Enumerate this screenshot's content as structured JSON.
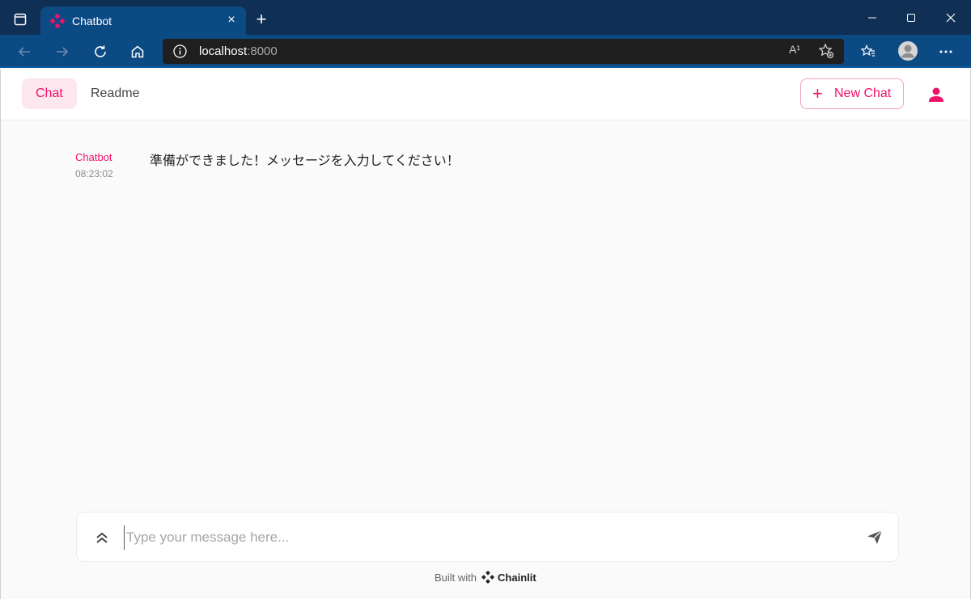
{
  "browser": {
    "tab_title": "Chatbot",
    "tab_close": "×",
    "new_tab": "+",
    "address_host": "localhost",
    "address_port": ":8000",
    "read_aloud": "A¹"
  },
  "header": {
    "tabs": [
      {
        "label": "Chat",
        "active": true
      },
      {
        "label": "Readme",
        "active": false
      }
    ],
    "new_chat_label": "New Chat",
    "new_chat_plus": "+"
  },
  "messages": [
    {
      "author": "Chatbot",
      "time": "08:23:02",
      "text": "準備ができました！メッセージを入力してください！"
    }
  ],
  "composer": {
    "placeholder": "Type your message here..."
  },
  "footer": {
    "built_with": "Built with",
    "brand": "Chainlit"
  },
  "colors": {
    "accent": "#f0116a",
    "titlebar": "#0f2f55",
    "toolbar": "#0c4a84"
  }
}
